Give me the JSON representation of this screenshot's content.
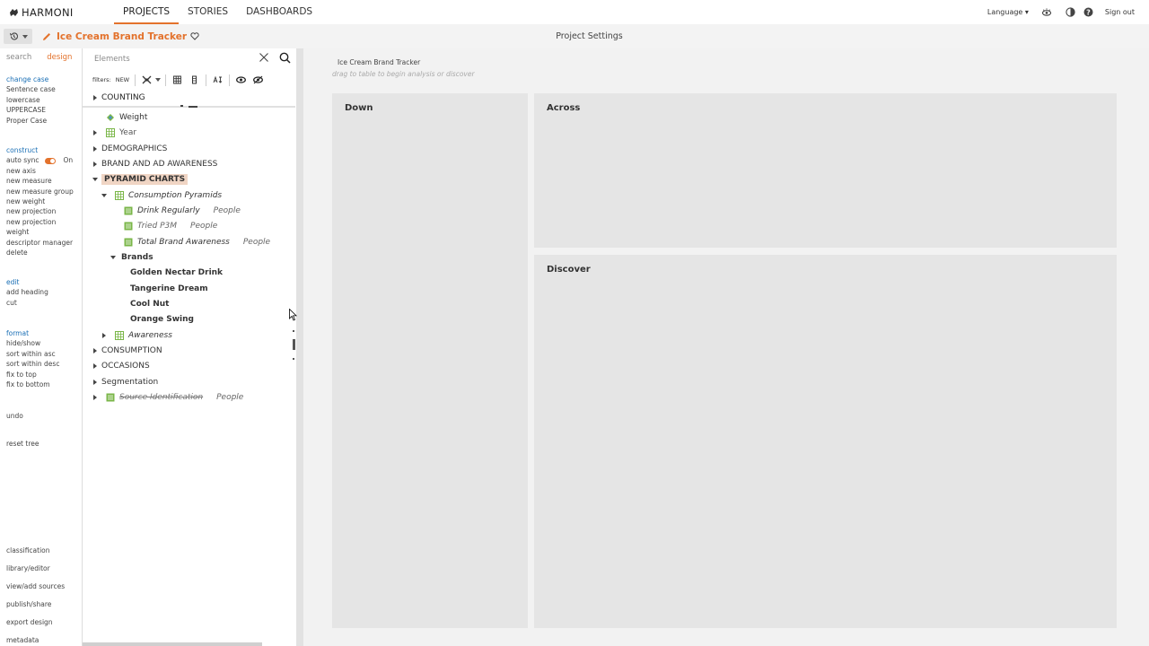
{
  "app": {
    "brand": "HARMONI",
    "nav": [
      "PROJECTS",
      "STORIES",
      "DASHBOARDS"
    ],
    "language_label": "Language",
    "signout_label": "Sign out"
  },
  "project": {
    "title": "Ice Cream Brand Tracker",
    "settings_label": "Project Settings"
  },
  "left_menu": {
    "tabs": [
      "search",
      "design"
    ],
    "change_case": {
      "heading": "change case",
      "items": [
        "Sentence case",
        "lowercase",
        "UPPERCASE",
        "Proper Case"
      ]
    },
    "construct": {
      "heading": "construct",
      "auto_sync_label": "auto sync",
      "auto_sync_state": "On",
      "items": [
        "new axis",
        "new measure",
        "new measure group",
        "new weight",
        "new projection",
        "new projection weight",
        "descriptor manager",
        "delete"
      ]
    },
    "edit": {
      "heading": "edit",
      "items": [
        "add heading",
        "cut"
      ]
    },
    "format": {
      "heading": "format",
      "items": [
        "hide/show",
        "sort within asc",
        "sort within desc",
        "fix to top",
        "fix to bottom"
      ]
    },
    "undo": "undo",
    "reset_tree": "reset tree",
    "bottom_items": [
      "classification",
      "library/editor",
      "view/add sources",
      "publish/share",
      "export design",
      "metadata"
    ]
  },
  "elements": {
    "search_placeholder": "Elements",
    "filters_label": "filters:",
    "filters_new": "NEW",
    "tree": {
      "counting": "COUNTING",
      "weight": "Weight",
      "year": "Year",
      "demographics": "DEMOGRAPHICS",
      "brand_awareness": "BRAND AND AD AWARENESS",
      "pyramid_charts": "PYRAMID CHARTS",
      "consumption_pyramids": "Consumption Pyramids",
      "drink_regularly": "Drink Regularly",
      "tried_p3m": "Tried P3M",
      "total_brand_awareness": "Total Brand Awareness",
      "people": "People",
      "brands": "Brands",
      "brand_items": [
        "Golden Nectar Drink",
        "Tangerine Dream",
        "Cool Nut",
        "Orange Swing"
      ],
      "awareness": "Awareness",
      "consumption": "CONSUMPTION",
      "occasions": "OCCASIONS",
      "segmentation": "Segmentation",
      "source_identification": "Source Identification"
    }
  },
  "canvas": {
    "title": "Ice Cream Brand Tracker",
    "hint": "drag to table to begin analysis or discover",
    "zones": [
      "Down",
      "Across",
      "Discover"
    ]
  },
  "colors": {
    "accent": "#e3722c",
    "link": "#1a6fb5",
    "tree_icon_green": "#7ab648"
  }
}
